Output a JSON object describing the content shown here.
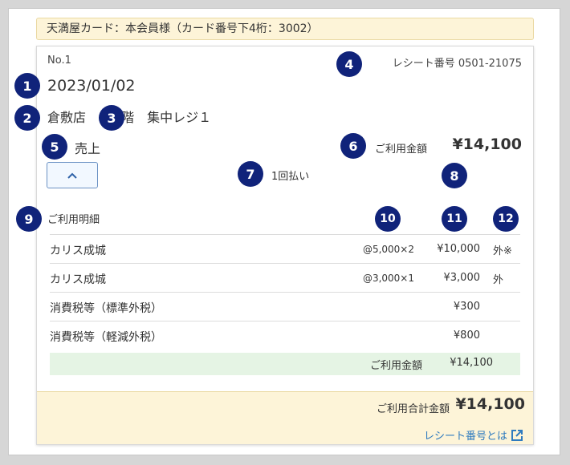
{
  "card": {
    "header": "天満屋カード：本会員様（カード番号下4桁：3002）"
  },
  "receipt": {
    "no": "No.1",
    "receipt_number": "レシート番号 0501-21075",
    "date": "2023/01/02",
    "store": "倉敷店",
    "register": "3階　集中レジ１",
    "kind": "売上",
    "amount_label": "ご利用金額",
    "amount": "¥14,100",
    "installment": "1回払い"
  },
  "details": {
    "title": "ご利用明細",
    "rows": [
      {
        "name": "カリス成城",
        "unit": "@5,000×2",
        "price": "¥10,000",
        "tax": "外※"
      },
      {
        "name": "カリス成城",
        "unit": "@3,000×1",
        "price": "¥3,000",
        "tax": "外"
      },
      {
        "name": "消費税等（標準外税）",
        "unit": "",
        "price": "¥300",
        "tax": ""
      },
      {
        "name": "消費税等（軽減外税）",
        "unit": "",
        "price": "¥800",
        "tax": ""
      }
    ],
    "subtotal_label": "ご利用金額",
    "subtotal": "¥14,100"
  },
  "footer": {
    "total_label": "ご利用合計金額",
    "total": "¥14,100",
    "help_link": "レシート番号とは"
  },
  "badges": [
    "1",
    "2",
    "3",
    "4",
    "5",
    "7",
    "8",
    "9",
    "10",
    "11",
    "12"
  ],
  "colors": {
    "badge": "#10237a",
    "link": "#2f7bbf",
    "header_bg": "#fdf4d8",
    "subtotal_bg": "#e5f4e4"
  }
}
